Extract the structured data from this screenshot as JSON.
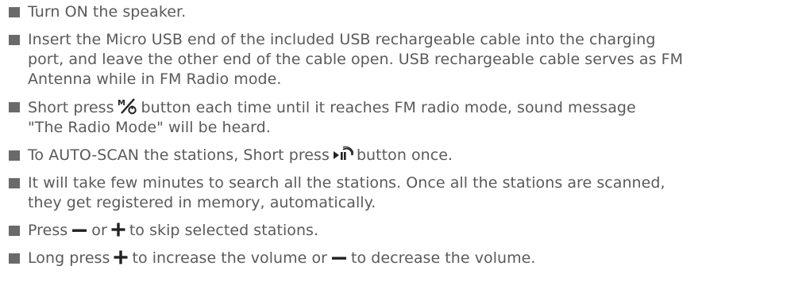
{
  "instructions": [
    {
      "lines": [
        "Turn ON the speaker."
      ]
    },
    {
      "lines": [
        "Insert the Micro USB end of the included USB rechargeable cable into the charging",
        "port, and leave the other end of the cable open. USB rechargeable cable serves as FM",
        "Antenna while in FM Radio mode."
      ]
    },
    {
      "line1_before": "Short press",
      "line1_after": "button each time until it reaches FM radio mode, sound message",
      "line2": "\"The Radio Mode\" will be heard.",
      "icon": "mode-switch-icon"
    },
    {
      "before": "To AUTO-SCAN the stations, Short press",
      "after": "button once.",
      "icon": "play-pause-icon"
    },
    {
      "lines": [
        "It will take few minutes to search all the stations. Once all the stations are scanned,",
        "they get registered in memory, automatically."
      ]
    },
    {
      "before": "Press",
      "middle": "or",
      "after": "to skip selected stations.",
      "icon1": "minus-icon",
      "icon2": "plus-icon"
    },
    {
      "before": "Long press",
      "middle": "to increase the volume or",
      "after": "to decrease the volume.",
      "icon1": "plus-icon",
      "icon2": "minus-icon"
    }
  ],
  "colors": {
    "text": "#5a5a5a",
    "bullet": "#6a6a6a",
    "icon": "#222222"
  }
}
